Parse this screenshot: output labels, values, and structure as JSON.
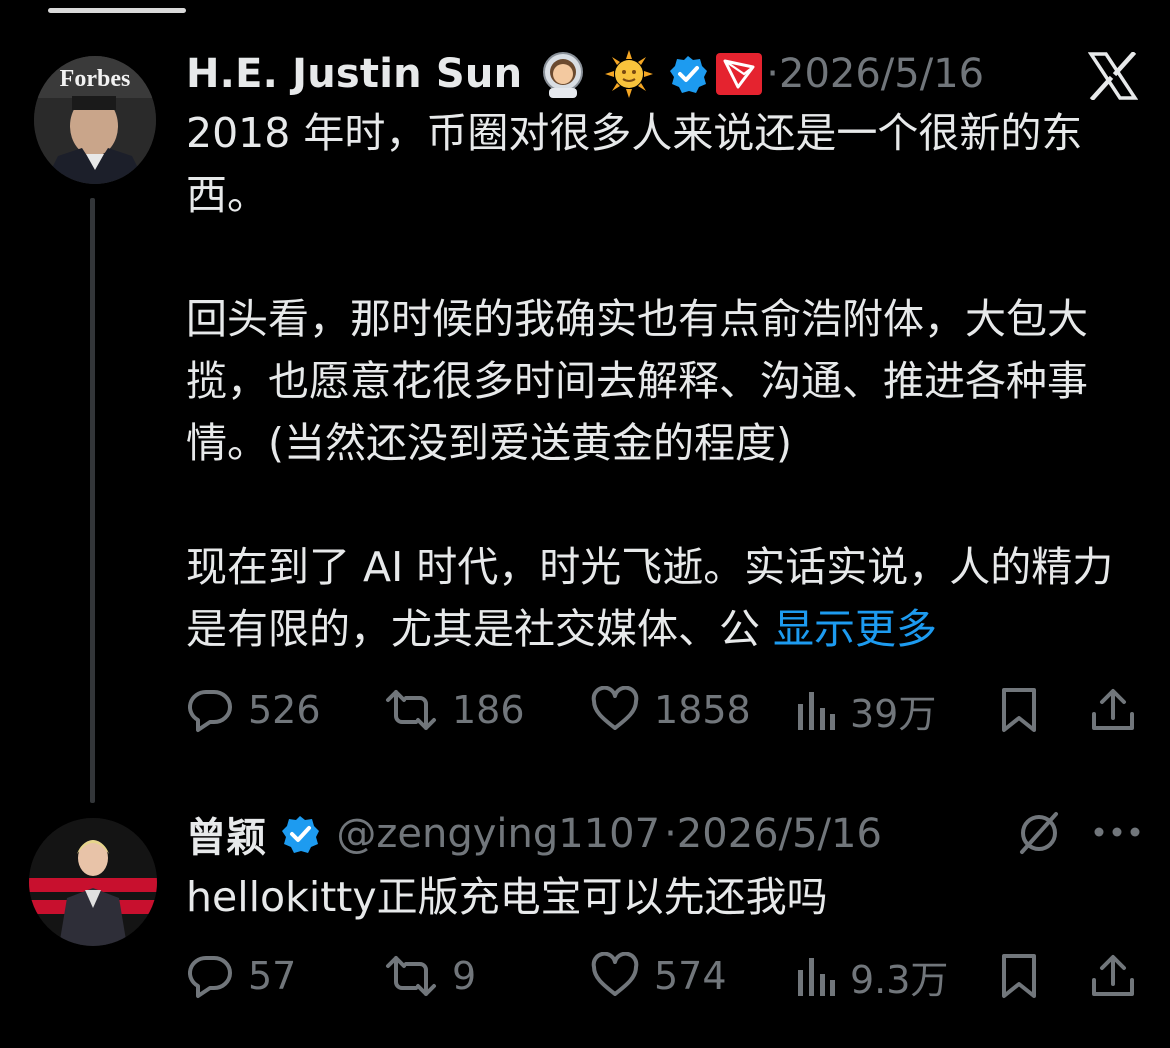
{
  "tweet_main": {
    "display_name": "H.E. Justin Sun",
    "emoji_1": "🧑‍🚀",
    "emoji_2": "🌞",
    "separator_date": "·2026/5/16",
    "avatar_label": "Forbes",
    "paragraphs": [
      "2018 年时，币圈对很多人来说还是一个很新的东西。",
      "回头看，那时候的我确实也有点俞浩附体，大包大揽，也愿意花很多时间去解释、沟通、推进各种事情。(当然还没到爱送黄金的程度)",
      "现在到了 AI 时代，时光飞逝。实话实说，人的精力是有限的，尤其是社交媒体、公"
    ],
    "show_more": "显示更多",
    "stats": {
      "replies": "526",
      "reposts": "186",
      "likes": "1858",
      "views": "39万"
    }
  },
  "tweet_reply": {
    "display_name": "曾颖",
    "handle": "@zengying1107",
    "separator_date": "·2026/5/16",
    "text": "hellokitty正版充电宝可以先还我吗",
    "stats": {
      "replies": "57",
      "reposts": "9",
      "likes": "574",
      "views": "9.3万"
    }
  },
  "icons": {
    "app_logo": "x-logo",
    "verified": "verified-badge-icon",
    "tron": "tron-icon",
    "reply": "reply-icon",
    "repost": "repost-icon",
    "like": "heart-icon",
    "views": "views-icon",
    "bookmark": "bookmark-icon",
    "share": "share-icon",
    "grok": "grok-icon",
    "more": "more-icon"
  },
  "colors": {
    "background": "#000000",
    "text": "#e7e9ea",
    "muted": "#71767b",
    "link": "#1d9bf0",
    "verified": "#1d9bf0",
    "tron": "#e5232f"
  }
}
